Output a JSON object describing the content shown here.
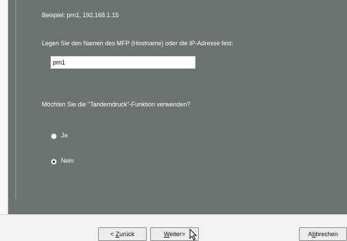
{
  "dialog": {
    "hint": "Beispiel: prn1, 192.168.1.15",
    "prompt": "Legen Sie den Namen des MFP (Hostname) oder die IP-Adresse fest:",
    "hostname_value": "prn1",
    "tandem_question": "Möchten Sie die \"Tandemdruck\"-Funktion verwenden?",
    "options": [
      {
        "label": "Ja",
        "selected": false
      },
      {
        "label": "Nein",
        "selected": true
      }
    ]
  },
  "buttons": {
    "back": {
      "prefix": "< ",
      "key": "Z",
      "rest": "urück"
    },
    "next": {
      "key": "W",
      "rest": "eiter",
      "suffix": ">"
    },
    "cancel": {
      "prefix": "A",
      "key": "b",
      "rest": "brechen"
    }
  },
  "colors": {
    "panel": "#6c7471",
    "panel_text": "#ffffff",
    "window": "#f3f3f3"
  }
}
